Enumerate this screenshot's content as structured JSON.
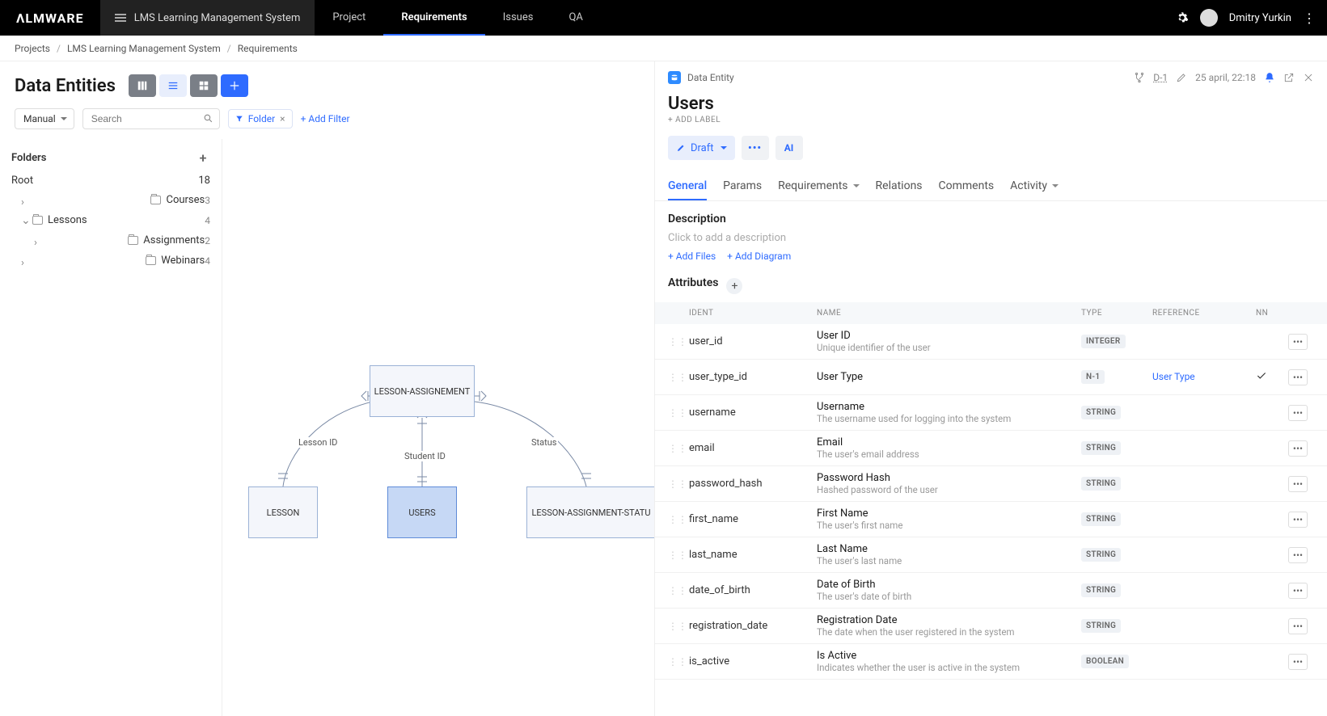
{
  "topbar": {
    "logo": "ΛLMWARE",
    "project": "LMS Learning Management System",
    "nav": [
      {
        "label": "Project",
        "active": false
      },
      {
        "label": "Requirements",
        "active": true
      },
      {
        "label": "Issues",
        "active": false
      },
      {
        "label": "QA",
        "active": false
      }
    ],
    "user": "Dmitry Yurkin"
  },
  "breadcrumbs": {
    "a": "Projects",
    "b": "LMS Learning Management System",
    "c": "Requirements"
  },
  "page": {
    "title": "Data Entities",
    "mode": "Manual",
    "search_placeholder": "Search",
    "folder_chip": "Folder",
    "add_filter": "+ Add Filter"
  },
  "folders": {
    "title": "Folders",
    "root": "Root",
    "root_count": "18",
    "items": [
      {
        "label": "Courses",
        "count": "3",
        "level": 1,
        "chev": "right"
      },
      {
        "label": "Lessons",
        "count": "4",
        "level": 1,
        "chev": "down"
      },
      {
        "label": "Assignments",
        "count": "2",
        "level": 2,
        "chev": "right"
      },
      {
        "label": "Webinars",
        "count": "4",
        "level": 1,
        "chev": "right"
      }
    ]
  },
  "diagram": {
    "nodes": {
      "la": "LESSON-ASSIGNEMENT",
      "lesson": "LESSON",
      "users": "USERS",
      "las": "LESSON-ASSIGNMENT-STATU"
    },
    "edges": {
      "lessonid": "Lesson ID",
      "studentid": "Student ID",
      "status": "Status"
    }
  },
  "detail": {
    "entity_type": "Data Entity",
    "id": "D-1",
    "date": "25 april, 22:18",
    "title": "Users",
    "add_label": "+ ADD LABEL",
    "status": "Draft",
    "ai": "AI",
    "tabs": [
      {
        "label": "General",
        "active": true
      },
      {
        "label": "Params",
        "dd": false
      },
      {
        "label": "Requirements",
        "dd": true
      },
      {
        "label": "Relations"
      },
      {
        "label": "Comments"
      },
      {
        "label": "Activity",
        "dd": true
      }
    ],
    "desc_title": "Description",
    "desc_placeholder": "Click to add a description",
    "add_files": "+ Add Files",
    "add_diagram": "+ Add Diagram",
    "attr_title": "Attributes",
    "cols": {
      "ident": "IDENT",
      "name": "NAME",
      "type": "TYPE",
      "ref": "REFERENCE",
      "nn": "NN"
    },
    "attrs": [
      {
        "ident": "user_id",
        "name": "User ID",
        "desc": "Unique identifier of the user",
        "type": "INTEGER",
        "ref": "",
        "nn": false
      },
      {
        "ident": "user_type_id",
        "name": "User Type",
        "desc": "",
        "type": "N-1",
        "ref": "User Type",
        "nn": true
      },
      {
        "ident": "username",
        "name": "Username",
        "desc": "The username used for logging into the system",
        "type": "STRING",
        "ref": "",
        "nn": false
      },
      {
        "ident": "email",
        "name": "Email",
        "desc": "The user's email address",
        "type": "STRING",
        "ref": "",
        "nn": false
      },
      {
        "ident": "password_hash",
        "name": "Password Hash",
        "desc": "Hashed password of the user",
        "type": "STRING",
        "ref": "",
        "nn": false
      },
      {
        "ident": "first_name",
        "name": "First Name",
        "desc": "The user's first name",
        "type": "STRING",
        "ref": "",
        "nn": false
      },
      {
        "ident": "last_name",
        "name": "Last Name",
        "desc": "The user's last name",
        "type": "STRING",
        "ref": "",
        "nn": false
      },
      {
        "ident": "date_of_birth",
        "name": "Date of Birth",
        "desc": "The user's date of birth",
        "type": "STRING",
        "ref": "",
        "nn": false
      },
      {
        "ident": "registration_date",
        "name": "Registration Date",
        "desc": "The date when the user registered in the system",
        "type": "STRING",
        "ref": "",
        "nn": false
      },
      {
        "ident": "is_active",
        "name": "Is Active",
        "desc": "Indicates whether the user is active in the system",
        "type": "BOOLEAN",
        "ref": "",
        "nn": false
      }
    ]
  }
}
